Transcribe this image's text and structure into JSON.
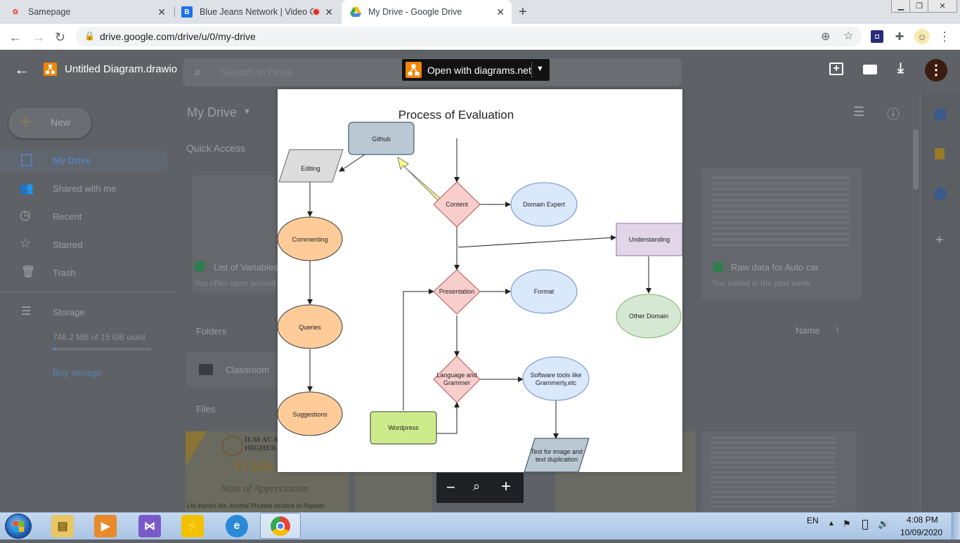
{
  "browser": {
    "tabs": [
      {
        "label": "Samepage"
      },
      {
        "label": "Blue Jeans Network | Video C"
      },
      {
        "label": "My Drive - Google Drive"
      }
    ],
    "url": "drive.google.com/drive/u/0/my-drive",
    "new_tab_symbol": "+"
  },
  "drive": {
    "search_placeholder": "Search in Drive",
    "new_label": "New",
    "page_title": "My Drive",
    "quick_access": "Quick Access",
    "sidebar": [
      {
        "label": "My Drive"
      },
      {
        "label": "Shared with me"
      },
      {
        "label": "Recent"
      },
      {
        "label": "Starred"
      },
      {
        "label": "Trash"
      },
      {
        "label": "Storage"
      }
    ],
    "storage_used": "746.2 MB of 15 GB used",
    "buy_storage": "Buy storage",
    "cards": [
      {
        "title": "List of Variables",
        "subtitle": "You often open around"
      },
      {
        "title": "Raw data for Auto car",
        "subtitle": "You edited in the past week"
      }
    ],
    "folders_label": "Folders",
    "files_label": "Files",
    "name_sort": "Name",
    "folder": "Classroom",
    "certificate": {
      "org": "ILM ACA",
      "sub": "HIGHER E",
      "flair": "FLAIR",
      "note": "Note of Appreciation",
      "line": "LM thanks Ms. Anchal Phutela student of Rajasth"
    }
  },
  "viewer": {
    "filename": "Untitled Diagram.drawio",
    "open_with": "Open with diagrams.net"
  },
  "diagram": {
    "title": "Process of Evaluation",
    "nodes": {
      "github": "Github",
      "editing": "Editing",
      "commenting": "Commenting",
      "queries": "Queries",
      "suggestions": "Suggestions",
      "content": "Content",
      "domain_expert": "Domain Expert",
      "understanding": "Understanding",
      "other_domain": "Other Domain",
      "presentation": "Presentation",
      "format": "Format",
      "language_l1": "Language and",
      "language_l2": "Grammer",
      "software_l1": "Software tools like",
      "software_l2": "Grammerly,etc",
      "wordpress": "Wordpress",
      "test_l1": "Test for image and",
      "test_l2": "text duplication"
    }
  },
  "taskbar": {
    "lang": "EN",
    "time": "4:08 PM",
    "date": "10/09/2020"
  }
}
